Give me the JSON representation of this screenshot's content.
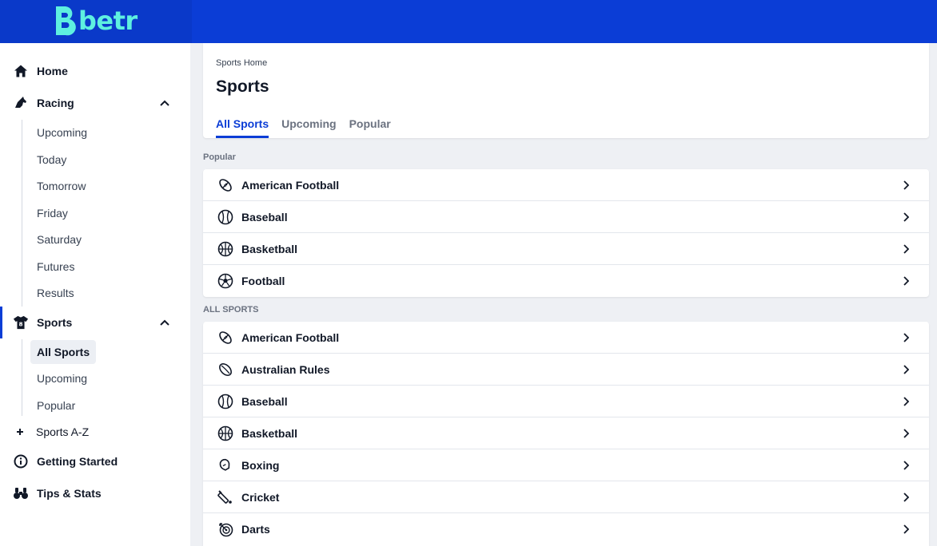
{
  "brand": {
    "name": "betr",
    "logo_color": "#5ef0e0",
    "header_color": "#0b3dd6"
  },
  "sidebar": {
    "items": [
      {
        "label": "Home",
        "icon": "home-icon"
      },
      {
        "label": "Racing",
        "icon": "horse-icon",
        "expanded": true,
        "children": [
          "Upcoming",
          "Today",
          "Tomorrow",
          "Friday",
          "Saturday",
          "Futures",
          "Results"
        ]
      },
      {
        "label": "Sports",
        "icon": "jersey-icon",
        "expanded": true,
        "active": true,
        "children": [
          "All Sports",
          "Upcoming",
          "Popular"
        ],
        "selected_child": "All Sports"
      },
      {
        "label": "Sports A-Z",
        "icon": "plus-icon"
      },
      {
        "label": "Getting Started",
        "icon": "info-icon"
      },
      {
        "label": "Tips & Stats",
        "icon": "binoculars-icon"
      }
    ]
  },
  "main": {
    "breadcrumb": "Sports Home",
    "title": "Sports",
    "tabs": [
      {
        "label": "All Sports",
        "active": true
      },
      {
        "label": "Upcoming",
        "active": false
      },
      {
        "label": "Popular",
        "active": false
      }
    ],
    "popular": {
      "label": "Popular",
      "items": [
        {
          "label": "American Football",
          "icon": "american-football-icon"
        },
        {
          "label": "Baseball",
          "icon": "baseball-icon"
        },
        {
          "label": "Basketball",
          "icon": "basketball-icon"
        },
        {
          "label": "Football",
          "icon": "soccer-ball-icon"
        }
      ]
    },
    "all_sports": {
      "label": "ALL SPORTS",
      "items": [
        {
          "label": "American Football",
          "icon": "american-football-icon"
        },
        {
          "label": "Australian Rules",
          "icon": "australian-rules-ball-icon"
        },
        {
          "label": "Baseball",
          "icon": "baseball-icon"
        },
        {
          "label": "Basketball",
          "icon": "basketball-icon"
        },
        {
          "label": "Boxing",
          "icon": "boxing-glove-icon"
        },
        {
          "label": "Cricket",
          "icon": "cricket-bat-icon"
        },
        {
          "label": "Darts",
          "icon": "dartboard-icon"
        }
      ]
    }
  }
}
